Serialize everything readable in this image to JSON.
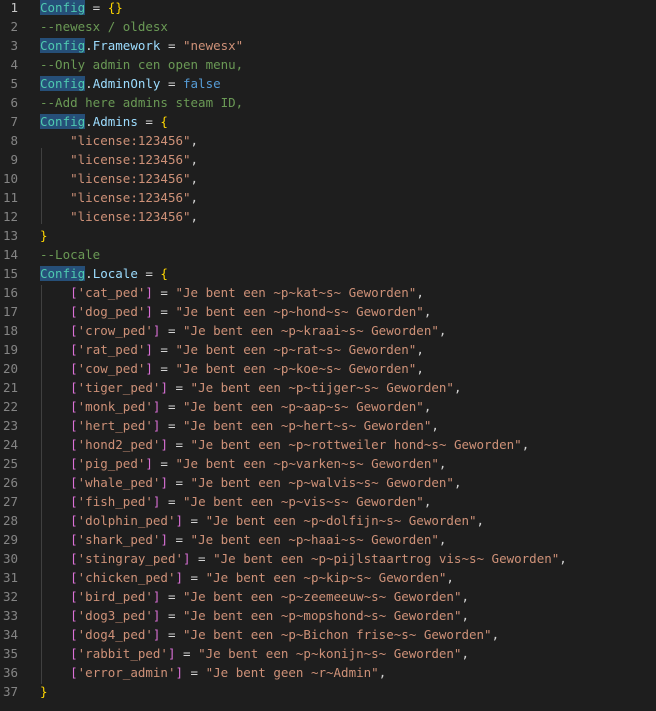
{
  "editor": {
    "lines": [
      {
        "n": "1",
        "tokens": [
          {
            "t": "Config",
            "c": "t-var hl"
          },
          {
            "t": " = ",
            "c": "t-op"
          },
          {
            "t": "{}",
            "c": "t-brace"
          }
        ]
      },
      {
        "n": "2",
        "tokens": [
          {
            "t": "--newesx / oldesx",
            "c": "t-com"
          }
        ]
      },
      {
        "n": "3",
        "tokens": [
          {
            "t": "Config",
            "c": "t-var hl"
          },
          {
            "t": ".",
            "c": "t-op"
          },
          {
            "t": "Framework",
            "c": "t-prop"
          },
          {
            "t": " = ",
            "c": "t-op"
          },
          {
            "t": "\"newesx\"",
            "c": "t-str"
          }
        ]
      },
      {
        "n": "4",
        "tokens": [
          {
            "t": "--Only admin cen open menu,",
            "c": "t-com"
          }
        ]
      },
      {
        "n": "5",
        "tokens": [
          {
            "t": "Config",
            "c": "t-var hl"
          },
          {
            "t": ".",
            "c": "t-op"
          },
          {
            "t": "AdminOnly",
            "c": "t-prop"
          },
          {
            "t": " = ",
            "c": "t-op"
          },
          {
            "t": "false",
            "c": "t-kw"
          }
        ]
      },
      {
        "n": "6",
        "tokens": [
          {
            "t": "--Add here admins steam ID,",
            "c": "t-com"
          }
        ]
      },
      {
        "n": "7",
        "tokens": [
          {
            "t": "Config",
            "c": "t-var hl"
          },
          {
            "t": ".",
            "c": "t-op"
          },
          {
            "t": "Admins",
            "c": "t-prop"
          },
          {
            "t": " = ",
            "c": "t-op"
          },
          {
            "t": "{",
            "c": "t-brace"
          }
        ]
      },
      {
        "n": "8",
        "tokens": [
          {
            "t": "    ",
            "c": "t-op"
          },
          {
            "t": "\"license:123456\"",
            "c": "t-str"
          },
          {
            "t": ",",
            "c": "t-op"
          }
        ]
      },
      {
        "n": "9",
        "tokens": [
          {
            "t": "    ",
            "c": "t-op"
          },
          {
            "t": "\"license:123456\"",
            "c": "t-str"
          },
          {
            "t": ",",
            "c": "t-op"
          }
        ]
      },
      {
        "n": "10",
        "tokens": [
          {
            "t": "    ",
            "c": "t-op"
          },
          {
            "t": "\"license:123456\"",
            "c": "t-str"
          },
          {
            "t": ",",
            "c": "t-op"
          }
        ]
      },
      {
        "n": "11",
        "tokens": [
          {
            "t": "    ",
            "c": "t-op"
          },
          {
            "t": "\"license:123456\"",
            "c": "t-str"
          },
          {
            "t": ",",
            "c": "t-op"
          }
        ]
      },
      {
        "n": "12",
        "tokens": [
          {
            "t": "    ",
            "c": "t-op"
          },
          {
            "t": "\"license:123456\"",
            "c": "t-str"
          },
          {
            "t": ",",
            "c": "t-op"
          }
        ]
      },
      {
        "n": "13",
        "tokens": [
          {
            "t": "}",
            "c": "t-brace"
          }
        ]
      },
      {
        "n": "14",
        "tokens": [
          {
            "t": "--Locale",
            "c": "t-com"
          }
        ]
      },
      {
        "n": "15",
        "tokens": [
          {
            "t": "Config",
            "c": "t-var hl"
          },
          {
            "t": ".",
            "c": "t-op"
          },
          {
            "t": "Locale",
            "c": "t-prop"
          },
          {
            "t": " = ",
            "c": "t-op"
          },
          {
            "t": "{",
            "c": "t-brace"
          }
        ]
      },
      {
        "n": "16",
        "tokens": [
          {
            "t": "    ",
            "c": "t-op"
          },
          {
            "t": "[",
            "c": "t-brace2"
          },
          {
            "t": "'cat_ped'",
            "c": "t-str"
          },
          {
            "t": "]",
            "c": "t-brace2"
          },
          {
            "t": " = ",
            "c": "t-op"
          },
          {
            "t": "\"Je bent een ~p~kat~s~ Geworden\"",
            "c": "t-str"
          },
          {
            "t": ",",
            "c": "t-op"
          }
        ]
      },
      {
        "n": "17",
        "tokens": [
          {
            "t": "    ",
            "c": "t-op"
          },
          {
            "t": "[",
            "c": "t-brace2"
          },
          {
            "t": "'dog_ped'",
            "c": "t-str"
          },
          {
            "t": "]",
            "c": "t-brace2"
          },
          {
            "t": " = ",
            "c": "t-op"
          },
          {
            "t": "\"Je bent een ~p~hond~s~ Geworden\"",
            "c": "t-str"
          },
          {
            "t": ",",
            "c": "t-op"
          }
        ]
      },
      {
        "n": "18",
        "tokens": [
          {
            "t": "    ",
            "c": "t-op"
          },
          {
            "t": "[",
            "c": "t-brace2"
          },
          {
            "t": "'crow_ped'",
            "c": "t-str"
          },
          {
            "t": "]",
            "c": "t-brace2"
          },
          {
            "t": " = ",
            "c": "t-op"
          },
          {
            "t": "\"Je bent een ~p~kraai~s~ Geworden\"",
            "c": "t-str"
          },
          {
            "t": ",",
            "c": "t-op"
          }
        ]
      },
      {
        "n": "19",
        "tokens": [
          {
            "t": "    ",
            "c": "t-op"
          },
          {
            "t": "[",
            "c": "t-brace2"
          },
          {
            "t": "'rat_ped'",
            "c": "t-str"
          },
          {
            "t": "]",
            "c": "t-brace2"
          },
          {
            "t": " = ",
            "c": "t-op"
          },
          {
            "t": "\"Je bent een ~p~rat~s~ Geworden\"",
            "c": "t-str"
          },
          {
            "t": ",",
            "c": "t-op"
          }
        ]
      },
      {
        "n": "20",
        "tokens": [
          {
            "t": "    ",
            "c": "t-op"
          },
          {
            "t": "[",
            "c": "t-brace2"
          },
          {
            "t": "'cow_ped'",
            "c": "t-str"
          },
          {
            "t": "]",
            "c": "t-brace2"
          },
          {
            "t": " = ",
            "c": "t-op"
          },
          {
            "t": "\"Je bent een ~p~koe~s~ Geworden\"",
            "c": "t-str"
          },
          {
            "t": ",",
            "c": "t-op"
          }
        ]
      },
      {
        "n": "21",
        "tokens": [
          {
            "t": "    ",
            "c": "t-op"
          },
          {
            "t": "[",
            "c": "t-brace2"
          },
          {
            "t": "'tiger_ped'",
            "c": "t-str"
          },
          {
            "t": "]",
            "c": "t-brace2"
          },
          {
            "t": " = ",
            "c": "t-op"
          },
          {
            "t": "\"Je bent een ~p~tijger~s~ Geworden\"",
            "c": "t-str"
          },
          {
            "t": ",",
            "c": "t-op"
          }
        ]
      },
      {
        "n": "22",
        "tokens": [
          {
            "t": "    ",
            "c": "t-op"
          },
          {
            "t": "[",
            "c": "t-brace2"
          },
          {
            "t": "'monk_ped'",
            "c": "t-str"
          },
          {
            "t": "]",
            "c": "t-brace2"
          },
          {
            "t": " = ",
            "c": "t-op"
          },
          {
            "t": "\"Je bent een ~p~aap~s~ Geworden\"",
            "c": "t-str"
          },
          {
            "t": ",",
            "c": "t-op"
          }
        ]
      },
      {
        "n": "23",
        "tokens": [
          {
            "t": "    ",
            "c": "t-op"
          },
          {
            "t": "[",
            "c": "t-brace2"
          },
          {
            "t": "'hert_ped'",
            "c": "t-str"
          },
          {
            "t": "]",
            "c": "t-brace2"
          },
          {
            "t": " = ",
            "c": "t-op"
          },
          {
            "t": "\"Je bent een ~p~hert~s~ Geworden\"",
            "c": "t-str"
          },
          {
            "t": ",",
            "c": "t-op"
          }
        ]
      },
      {
        "n": "24",
        "tokens": [
          {
            "t": "    ",
            "c": "t-op"
          },
          {
            "t": "[",
            "c": "t-brace2"
          },
          {
            "t": "'hond2_ped'",
            "c": "t-str"
          },
          {
            "t": "]",
            "c": "t-brace2"
          },
          {
            "t": " = ",
            "c": "t-op"
          },
          {
            "t": "\"Je bent een ~p~rottweiler hond~s~ Geworden\"",
            "c": "t-str"
          },
          {
            "t": ",",
            "c": "t-op"
          }
        ]
      },
      {
        "n": "25",
        "tokens": [
          {
            "t": "    ",
            "c": "t-op"
          },
          {
            "t": "[",
            "c": "t-brace2"
          },
          {
            "t": "'pig_ped'",
            "c": "t-str"
          },
          {
            "t": "]",
            "c": "t-brace2"
          },
          {
            "t": " = ",
            "c": "t-op"
          },
          {
            "t": "\"Je bent een ~p~varken~s~ Geworden\"",
            "c": "t-str"
          },
          {
            "t": ",",
            "c": "t-op"
          }
        ]
      },
      {
        "n": "26",
        "tokens": [
          {
            "t": "    ",
            "c": "t-op"
          },
          {
            "t": "[",
            "c": "t-brace2"
          },
          {
            "t": "'whale_ped'",
            "c": "t-str"
          },
          {
            "t": "]",
            "c": "t-brace2"
          },
          {
            "t": " = ",
            "c": "t-op"
          },
          {
            "t": "\"Je bent een ~p~walvis~s~ Geworden\"",
            "c": "t-str"
          },
          {
            "t": ",",
            "c": "t-op"
          }
        ]
      },
      {
        "n": "27",
        "tokens": [
          {
            "t": "    ",
            "c": "t-op"
          },
          {
            "t": "[",
            "c": "t-brace2"
          },
          {
            "t": "'fish_ped'",
            "c": "t-str"
          },
          {
            "t": "]",
            "c": "t-brace2"
          },
          {
            "t": " = ",
            "c": "t-op"
          },
          {
            "t": "\"Je bent een ~p~vis~s~ Geworden\"",
            "c": "t-str"
          },
          {
            "t": ",",
            "c": "t-op"
          }
        ]
      },
      {
        "n": "28",
        "tokens": [
          {
            "t": "    ",
            "c": "t-op"
          },
          {
            "t": "[",
            "c": "t-brace2"
          },
          {
            "t": "'dolphin_ped'",
            "c": "t-str"
          },
          {
            "t": "]",
            "c": "t-brace2"
          },
          {
            "t": " = ",
            "c": "t-op"
          },
          {
            "t": "\"Je bent een ~p~dolfijn~s~ Geworden\"",
            "c": "t-str"
          },
          {
            "t": ",",
            "c": "t-op"
          }
        ]
      },
      {
        "n": "29",
        "tokens": [
          {
            "t": "    ",
            "c": "t-op"
          },
          {
            "t": "[",
            "c": "t-brace2"
          },
          {
            "t": "'shark_ped'",
            "c": "t-str"
          },
          {
            "t": "]",
            "c": "t-brace2"
          },
          {
            "t": " = ",
            "c": "t-op"
          },
          {
            "t": "\"Je bent een ~p~haai~s~ Geworden\"",
            "c": "t-str"
          },
          {
            "t": ",",
            "c": "t-op"
          }
        ]
      },
      {
        "n": "30",
        "tokens": [
          {
            "t": "    ",
            "c": "t-op"
          },
          {
            "t": "[",
            "c": "t-brace2"
          },
          {
            "t": "'stingray_ped'",
            "c": "t-str"
          },
          {
            "t": "]",
            "c": "t-brace2"
          },
          {
            "t": " = ",
            "c": "t-op"
          },
          {
            "t": "\"Je bent een ~p~pijlstaartrog vis~s~ Geworden\"",
            "c": "t-str"
          },
          {
            "t": ",",
            "c": "t-op"
          }
        ]
      },
      {
        "n": "31",
        "tokens": [
          {
            "t": "    ",
            "c": "t-op"
          },
          {
            "t": "[",
            "c": "t-brace2"
          },
          {
            "t": "'chicken_ped'",
            "c": "t-str"
          },
          {
            "t": "]",
            "c": "t-brace2"
          },
          {
            "t": " = ",
            "c": "t-op"
          },
          {
            "t": "\"Je bent een ~p~kip~s~ Geworden\"",
            "c": "t-str"
          },
          {
            "t": ",",
            "c": "t-op"
          }
        ]
      },
      {
        "n": "32",
        "tokens": [
          {
            "t": "    ",
            "c": "t-op"
          },
          {
            "t": "[",
            "c": "t-brace2"
          },
          {
            "t": "'bird_ped'",
            "c": "t-str"
          },
          {
            "t": "]",
            "c": "t-brace2"
          },
          {
            "t": " = ",
            "c": "t-op"
          },
          {
            "t": "\"Je bent een ~p~zeemeeuw~s~ Geworden\"",
            "c": "t-str"
          },
          {
            "t": ",",
            "c": "t-op"
          }
        ]
      },
      {
        "n": "33",
        "tokens": [
          {
            "t": "    ",
            "c": "t-op"
          },
          {
            "t": "[",
            "c": "t-brace2"
          },
          {
            "t": "'dog3_ped'",
            "c": "t-str"
          },
          {
            "t": "]",
            "c": "t-brace2"
          },
          {
            "t": " = ",
            "c": "t-op"
          },
          {
            "t": "\"Je bent een ~p~mopshond~s~ Geworden\"",
            "c": "t-str"
          },
          {
            "t": ",",
            "c": "t-op"
          }
        ]
      },
      {
        "n": "34",
        "tokens": [
          {
            "t": "    ",
            "c": "t-op"
          },
          {
            "t": "[",
            "c": "t-brace2"
          },
          {
            "t": "'dog4_ped'",
            "c": "t-str"
          },
          {
            "t": "]",
            "c": "t-brace2"
          },
          {
            "t": " = ",
            "c": "t-op"
          },
          {
            "t": "\"Je bent een ~p~Bichon frise~s~ Geworden\"",
            "c": "t-str"
          },
          {
            "t": ",",
            "c": "t-op"
          }
        ]
      },
      {
        "n": "35",
        "tokens": [
          {
            "t": "    ",
            "c": "t-op"
          },
          {
            "t": "[",
            "c": "t-brace2"
          },
          {
            "t": "'rabbit_ped'",
            "c": "t-str"
          },
          {
            "t": "]",
            "c": "t-brace2"
          },
          {
            "t": " = ",
            "c": "t-op"
          },
          {
            "t": "\"Je bent een ~p~konijn~s~ Geworden\"",
            "c": "t-str"
          },
          {
            "t": ",",
            "c": "t-op"
          }
        ]
      },
      {
        "n": "36",
        "tokens": [
          {
            "t": "    ",
            "c": "t-op"
          },
          {
            "t": "[",
            "c": "t-brace2"
          },
          {
            "t": "'error_admin'",
            "c": "t-str"
          },
          {
            "t": "]",
            "c": "t-brace2"
          },
          {
            "t": " = ",
            "c": "t-op"
          },
          {
            "t": "\"Je bent geen ~r~Admin\"",
            "c": "t-str"
          },
          {
            "t": ",",
            "c": "t-op"
          }
        ]
      },
      {
        "n": "37",
        "tokens": [
          {
            "t": "}",
            "c": "t-brace"
          }
        ]
      }
    ],
    "active_line": "1",
    "colors": {
      "background": "#1e1e1e",
      "line_number": "#858585",
      "comment": "#6a9955",
      "string": "#ce9178",
      "property": "#9cdcfe",
      "variable": "#4ec9b0",
      "keyword": "#569cd6",
      "brace": "#ffd700",
      "bracket": "#da70d6"
    }
  }
}
